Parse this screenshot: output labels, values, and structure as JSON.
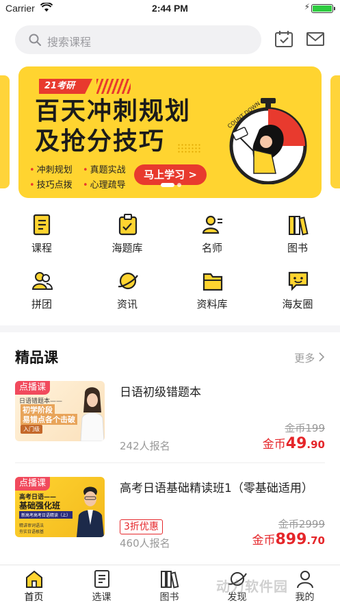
{
  "status_bar": {
    "carrier": "Carrier",
    "time": "2:44 PM"
  },
  "search": {
    "placeholder": "搜索课程"
  },
  "banner": {
    "tag": "21考研",
    "title_line1": "百天冲刺规划",
    "title_line2": "及抢分技巧",
    "points": [
      "冲刺规划",
      "真题实战",
      "技巧点拨",
      "心理疏导"
    ],
    "cta": "马上学习 >",
    "count_down": "COUNT DOWN"
  },
  "nav_grid": [
    {
      "label": "课程",
      "icon": "course-icon"
    },
    {
      "label": "海题库",
      "icon": "question-bank-icon"
    },
    {
      "label": "名师",
      "icon": "teacher-icon"
    },
    {
      "label": "图书",
      "icon": "books-icon"
    },
    {
      "label": "拼团",
      "icon": "group-buy-icon"
    },
    {
      "label": "资讯",
      "icon": "news-icon"
    },
    {
      "label": "资料库",
      "icon": "folder-icon"
    },
    {
      "label": "海友圈",
      "icon": "chat-icon"
    }
  ],
  "section": {
    "title": "精品课",
    "more": "更多"
  },
  "courses": [
    {
      "badge": "点播课",
      "thumb_lines": [
        "日语错题本——",
        "初学阶段",
        "易错点各个击破",
        "入门级"
      ],
      "name": "日语初级错题本",
      "enroll": "242人报名",
      "old_price": "金币199",
      "price_prefix": "金币",
      "price_int": "49",
      "price_dec": ".90"
    },
    {
      "badge": "点播课",
      "thumb_lines": [
        "高考日语——",
        "基础强化班",
        "新高考高考日语精读（上）",
        "精讲审词语法",
        "夯实日语根基"
      ],
      "name": "高考日语基础精读班1（零基础适用）",
      "discount": "3折优惠",
      "enroll": "460人报名",
      "old_price": "金币2999",
      "price_prefix": "金币",
      "price_int": "899",
      "price_dec": ".70"
    }
  ],
  "tabbar": [
    {
      "label": "首页",
      "icon": "home-icon",
      "active": true
    },
    {
      "label": "选课",
      "icon": "select-course-icon"
    },
    {
      "label": "图书",
      "icon": "books-icon"
    },
    {
      "label": "发现",
      "icon": "discover-icon"
    },
    {
      "label": "我的",
      "icon": "profile-icon"
    }
  ],
  "watermark": "动力软件园",
  "colors": {
    "brand_yellow": "#FFD430",
    "accent_red": "#E83A2E",
    "price_red": "#E5262A"
  }
}
